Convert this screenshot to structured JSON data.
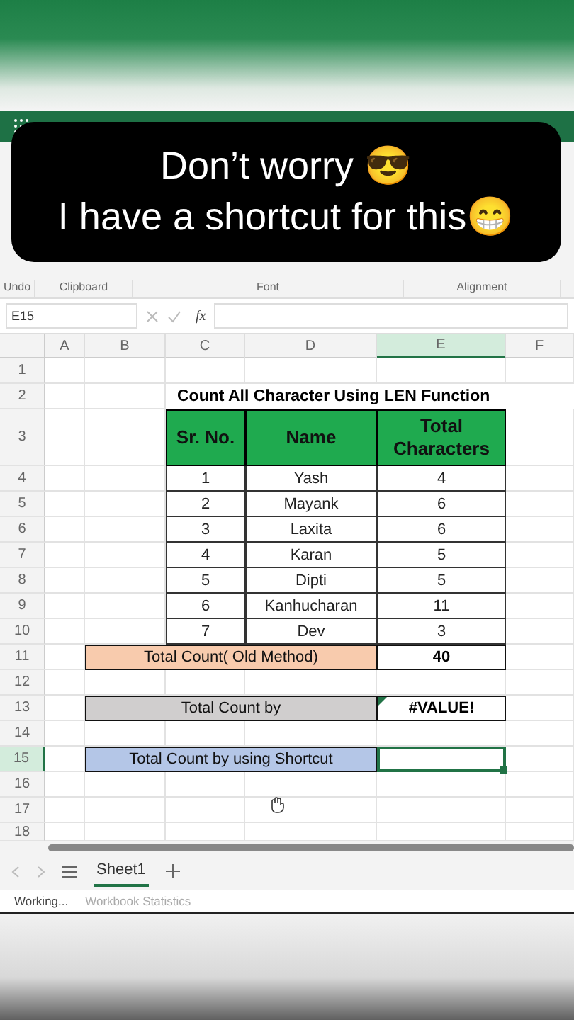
{
  "caption": {
    "lines": [
      "Don’t worry 😎",
      "I have a shortcut for this😁"
    ]
  },
  "ribbon": {
    "groups": [
      "Undo",
      "Clipboard",
      "Font",
      "Alignment"
    ]
  },
  "formula_bar": {
    "name_box": "E15",
    "fx": "fx"
  },
  "sheet": {
    "columns": [
      {
        "label": "A",
        "selected": false
      },
      {
        "label": "B",
        "selected": false
      },
      {
        "label": "C",
        "selected": false
      },
      {
        "label": "D",
        "selected": false
      },
      {
        "label": "E",
        "selected": true
      },
      {
        "label": "F",
        "selected": false
      }
    ],
    "rows": [
      {
        "label": "1",
        "selected": false
      },
      {
        "label": "2",
        "selected": false
      },
      {
        "label": "3",
        "selected": false
      },
      {
        "label": "4",
        "selected": false
      },
      {
        "label": "5",
        "selected": false
      },
      {
        "label": "6",
        "selected": false
      },
      {
        "label": "7",
        "selected": false
      },
      {
        "label": "8",
        "selected": false
      },
      {
        "label": "9",
        "selected": false
      },
      {
        "label": "10",
        "selected": false
      },
      {
        "label": "11",
        "selected": false
      },
      {
        "label": "12",
        "selected": false
      },
      {
        "label": "13",
        "selected": false
      },
      {
        "label": "14",
        "selected": false
      },
      {
        "label": "15",
        "selected": true
      },
      {
        "label": "16",
        "selected": false
      },
      {
        "label": "17",
        "selected": false
      },
      {
        "label": "18",
        "selected": false
      }
    ],
    "title": "Count All Character Using LEN Function",
    "headers": [
      "Sr. No.",
      "Name",
      "Total Characters"
    ],
    "data": [
      [
        "1",
        "Yash",
        "4"
      ],
      [
        "2",
        "Mayank",
        "6"
      ],
      [
        "3",
        "Laxita",
        "6"
      ],
      [
        "4",
        "Karan",
        "5"
      ],
      [
        "5",
        "Dipti",
        "5"
      ],
      [
        "6",
        "Kanhucharan",
        "11"
      ],
      [
        "7",
        "Dev",
        "3"
      ]
    ],
    "totals": [
      {
        "label": "Total Count( Old Method)",
        "value": "40",
        "color": "#f8cbad",
        "error_flag": false,
        "selected": false
      },
      {
        "label": "Total Count by",
        "value": "#VALUE!",
        "color": "#d0cece",
        "error_flag": true,
        "selected": false
      },
      {
        "label": "Total Count by using Shortcut",
        "color": "#b4c6e7",
        "error_flag": false,
        "selected": true
      }
    ]
  },
  "sheet_tabs": [
    {
      "label": "Sheet1",
      "selected": true
    }
  ],
  "status_bar": [
    "Working...",
    "Workbook Statistics"
  ]
}
